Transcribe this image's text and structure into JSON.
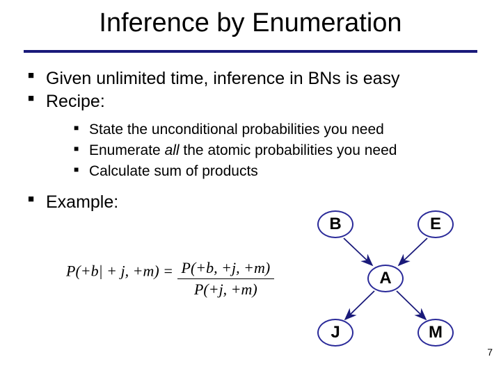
{
  "title": "Inference by Enumeration",
  "bullets": {
    "b1": "Given unlimited time, inference in BNs is easy",
    "b2": "Recipe:",
    "b2a": "State the unconditional probabilities you need",
    "b2b_pre": "Enumerate ",
    "b2b_em": "all",
    "b2b_post": " the atomic probabilities you need",
    "b2c": "Calculate sum of products",
    "b3": "Example:"
  },
  "formula": {
    "lhs": "P(+b| + j, +m) =",
    "num": "P(+b, +j, +m)",
    "den": "P(+j, +m)"
  },
  "nodes": {
    "B": "B",
    "E": "E",
    "A": "A",
    "J": "J",
    "M": "M"
  },
  "pagenum": "7"
}
